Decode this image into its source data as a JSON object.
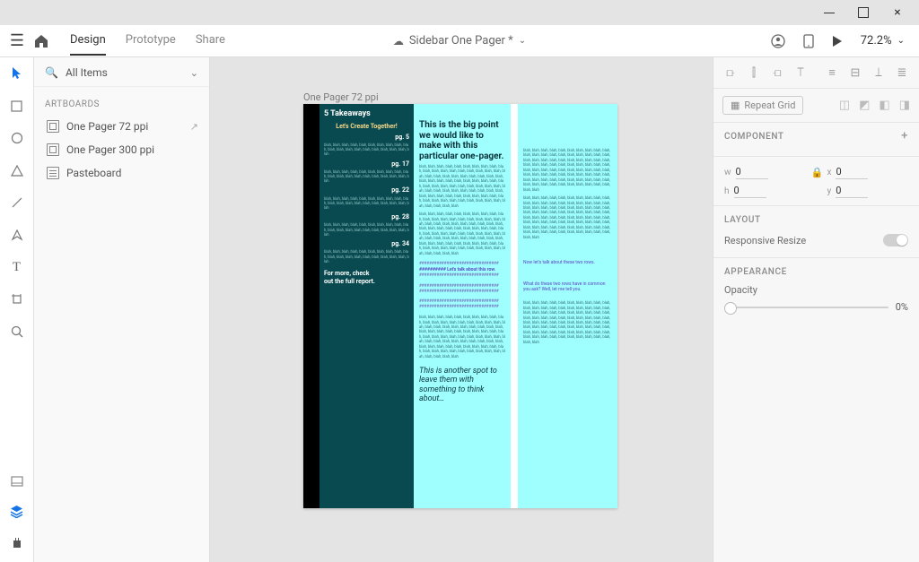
{
  "window": {
    "title": "Sidebar One Pager *"
  },
  "tabs": {
    "design": "Design",
    "prototype": "Prototype",
    "share": "Share",
    "active": "design"
  },
  "zoom": "72.2%",
  "layers": {
    "filter": "All Items",
    "section": "ARTBOARDS",
    "items": [
      {
        "label": "One Pager 72 ppi",
        "ext": true
      },
      {
        "label": "One Pager 300 ppi",
        "ext": false
      },
      {
        "label": "Pasteboard",
        "ext": false,
        "paste": true
      }
    ]
  },
  "artboard": {
    "label": "One Pager 72 ppi",
    "teal": {
      "heading": "5 Takeaways",
      "create": "Let's Create Together!",
      "pages": [
        "pg. 5",
        "pg. 17",
        "pg. 22",
        "pg. 28",
        "pg. 34"
      ],
      "blah": "blah, blah, blah, blah, blah, blah, blah, blah, blah, blah, blah, blah, blah, blah, blah, blah, blah, blah, blah, blah",
      "footer1": "For more, check",
      "footer2": "out the full report."
    },
    "main": {
      "bigpoint": "This is the big point we would like to make with this particular one-pager.",
      "para": "blah, blah, blah, blah, blah, blah, blah, blah, blah, blah, blah, blah, blah, blah, blah, blah, blah, blah, blah, blah, blah, blah, blah, blah, blah, blah, blah, blah, blah, blah, blah, blah, blah, blah, blah, blah, blah, blah, blah, blah, blah, blah, blah, blah, blah, blah, blah, blah, blah, blah, blah, blah, blah, blah, blah, blah, blah, blah, blah, blah, blah, blah, blah, blah, blah, blah, blah, blah, blah, blah, blah, blah, blah, blah, blah, blah, blah, blah, blah, blah, blah, blah",
      "row1": "########## Let's talk about this row.",
      "row2": "Now let's talk about these two rows.",
      "row3": "What do these two rows have in common you ask?  Well, let me tell you.",
      "hashes": "################################",
      "closing": "This is another spot to leave them with something to think about…"
    }
  },
  "props": {
    "repeat": "Repeat Grid",
    "component": "COMPONENT",
    "w": "0",
    "x": "0",
    "h": "0",
    "y": "0",
    "layout": "LAYOUT",
    "resize": "Responsive Resize",
    "appearance": "APPEARANCE",
    "opacity_label": "Opacity",
    "opacity": "0%"
  }
}
